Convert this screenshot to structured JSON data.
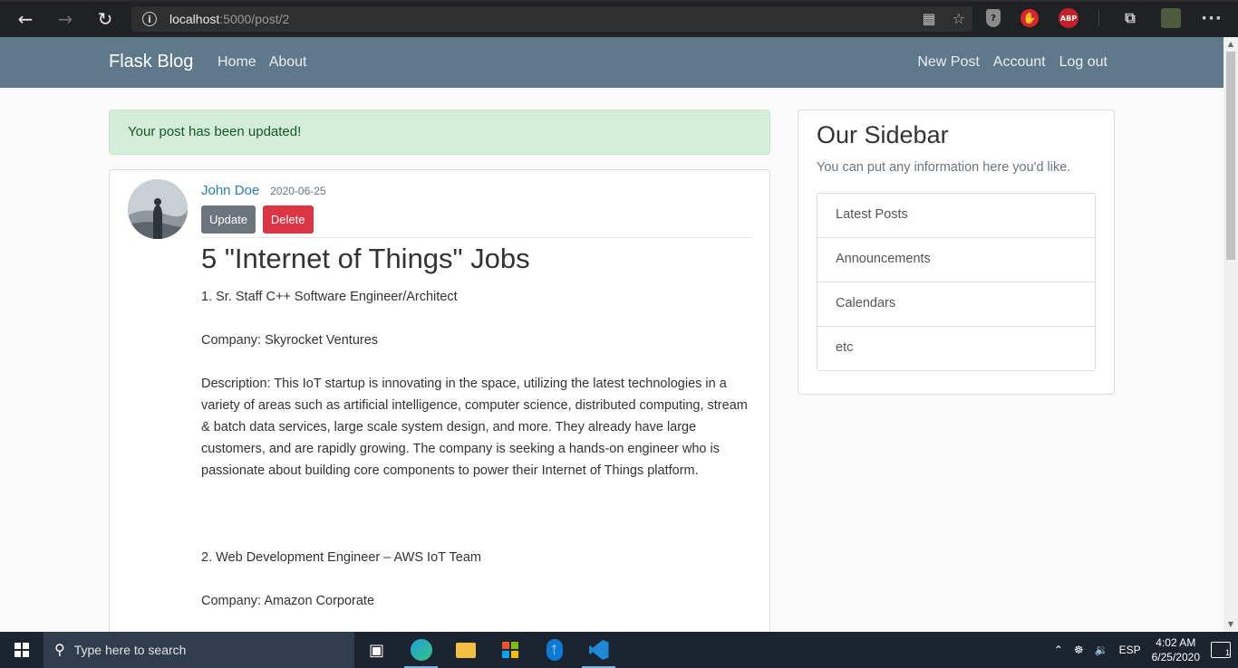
{
  "browser": {
    "url_host": "localhost",
    "url_rest": ":5000/post/2"
  },
  "navbar": {
    "brand": "Flask Blog",
    "left_links": [
      "Home",
      "About"
    ],
    "right_links": [
      "New Post",
      "Account",
      "Log out"
    ]
  },
  "alert": {
    "message": "Your post has been updated!"
  },
  "post": {
    "author": "John Doe",
    "date": "2020-06-25",
    "update_label": "Update",
    "delete_label": "Delete",
    "title": "5 \"Internet of Things\" Jobs",
    "paragraphs": [
      "1. Sr. Staff C++ Software Engineer/Architect",
      "Company: Skyrocket Ventures",
      "Description: This IoT startup is innovating in the space, utilizing the latest technologies in a variety of areas such as artificial intelligence, computer science, distributed computing, stream & batch data services, large scale system design, and more. They already have large customers, and are rapidly growing. The company is seeking a hands-on engineer who is passionate about building core components to power their Internet of Things platform.",
      "2. Web Development Engineer – AWS IoT Team",
      "Company: Amazon Corporate"
    ]
  },
  "sidebar": {
    "title": "Our Sidebar",
    "subtitle": "You can put any information here you'd like.",
    "items": [
      "Latest Posts",
      "Announcements",
      "Calendars",
      "etc"
    ]
  },
  "taskbar": {
    "search_placeholder": "Type here to search",
    "language": "ESP",
    "time": "4:02 AM",
    "date": "6/25/2020",
    "notification_count": "1"
  }
}
